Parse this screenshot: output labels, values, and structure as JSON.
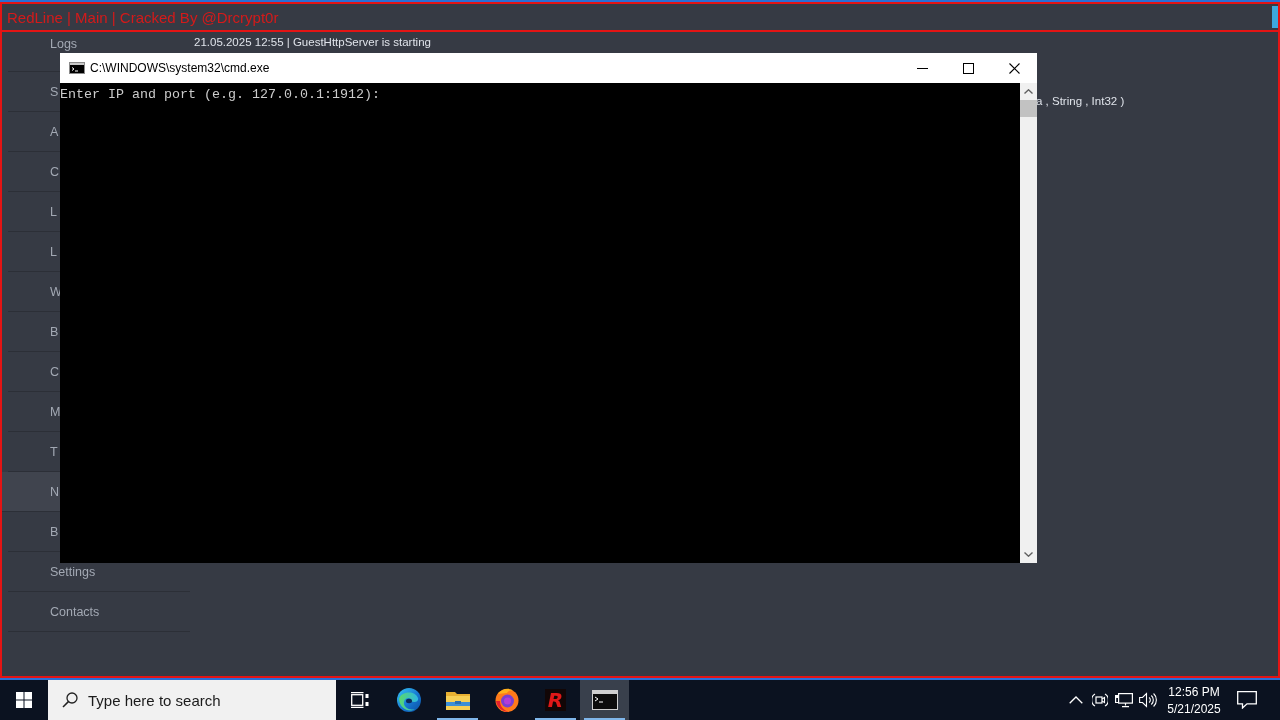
{
  "app_window": {
    "title": "RedLine | Main | Cracked By @Drcrypt0r"
  },
  "sidebar": {
    "items": [
      {
        "label": "Logs",
        "selected": false
      },
      {
        "label": "S",
        "selected": false
      },
      {
        "label": "A",
        "selected": false
      },
      {
        "label": "C",
        "selected": false
      },
      {
        "label": "L",
        "selected": false
      },
      {
        "label": "L",
        "selected": false
      },
      {
        "label": "W",
        "selected": false
      },
      {
        "label": "B",
        "selected": false
      },
      {
        "label": "C",
        "selected": false
      },
      {
        "label": "M",
        "selected": false
      },
      {
        "label": "T",
        "selected": false
      },
      {
        "label": "N",
        "selected": true
      },
      {
        "label": "B",
        "selected": false
      },
      {
        "label": "Settings",
        "selected": false
      },
      {
        "label": "Contacts",
        "selected": false
      }
    ]
  },
  "log": {
    "lines": [
      {
        "kind": "line",
        "text": "21.05.2025 12:55 | GuestHttpServer is starting"
      },
      {
        "kind": "tail",
        "text": "a , String , Int32 )"
      }
    ]
  },
  "console_window": {
    "title": "C:\\WINDOWS\\system32\\cmd.exe",
    "output": "Enter IP and port (e.g. 127.0.0.1:1912):"
  },
  "taskbar": {
    "search": {
      "placeholder": "Type here to search"
    },
    "apps": [
      {
        "kind": "edge",
        "running": false,
        "active": false
      },
      {
        "kind": "explorer",
        "running": true,
        "active": false
      },
      {
        "kind": "firefox",
        "running": false,
        "active": false
      },
      {
        "kind": "redline",
        "glyph": "R",
        "running": true,
        "active": false
      },
      {
        "kind": "console",
        "running": true,
        "active": true
      }
    ],
    "clock": {
      "time": "12:56 PM",
      "date": "5/21/2025"
    }
  }
}
